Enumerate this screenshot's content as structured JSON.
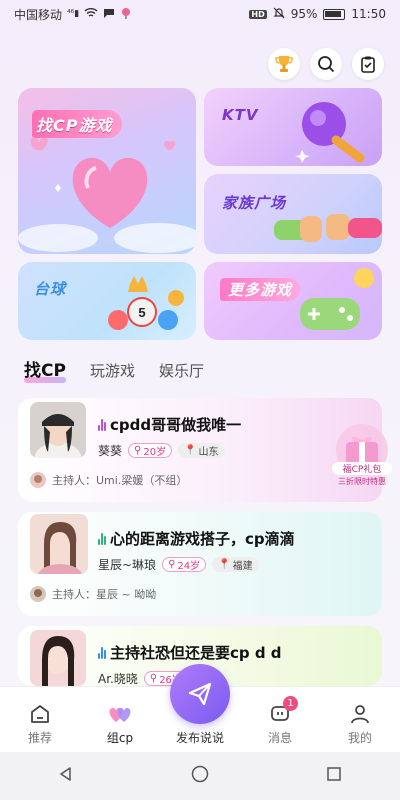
{
  "status_bar": {
    "carrier": "中国移动",
    "battery": "95%",
    "time": "11:50"
  },
  "cards": {
    "cp": "找CP游戏",
    "ktv": "KTV",
    "family": "家族广场",
    "billiard": "台球",
    "more": "更多游戏"
  },
  "tabs": [
    "找CP",
    "玩游戏",
    "娱乐厅"
  ],
  "rooms": [
    {
      "title": "cpdd哥哥做我唯一",
      "name": "葵葵",
      "age": "20岁",
      "location": "山东",
      "host_label": "主持人：",
      "host": "Umi.梁媛（不组）",
      "bar_color": "#c04fd8"
    },
    {
      "title": "心的距离游戏搭子，cp滴滴",
      "name": "星辰~琳琅",
      "age": "24岁",
      "location": "福建",
      "host_label": "主持人：",
      "host": "星辰 ~ 呦呦",
      "bar_color": "#2fb27d"
    },
    {
      "title": "主持社恐但还是要cp d d",
      "name": "Ar.晓晓",
      "age": "26岁",
      "location": "",
      "host_label": "",
      "host": "",
      "bar_color": "#3b8ee8"
    }
  ],
  "gift_badge": {
    "line1": "福CP礼包",
    "line2": "三折限时特惠"
  },
  "nav": {
    "recommend": "推荐",
    "group_cp": "组cp",
    "publish": "发布说说",
    "messages": "消息",
    "messages_count": "1",
    "me": "我的"
  }
}
